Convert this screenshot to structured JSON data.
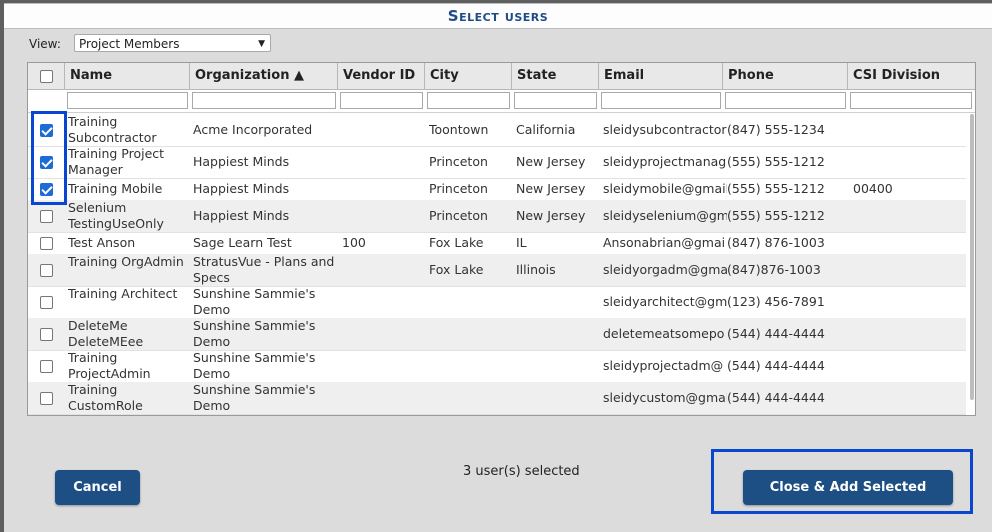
{
  "dialog": {
    "title": "Select users"
  },
  "view": {
    "label": "View:",
    "selected": "Project Members"
  },
  "columns": [
    {
      "label": ""
    },
    {
      "label": "Name"
    },
    {
      "label": "Organization ▲"
    },
    {
      "label": "Vendor ID"
    },
    {
      "label": "City"
    },
    {
      "label": "State"
    },
    {
      "label": "Email"
    },
    {
      "label": "Phone"
    },
    {
      "label": "CSI Division"
    }
  ],
  "rows": [
    {
      "checked": true,
      "name": "Training Subcontractor",
      "org": "Acme Incorporated",
      "vendor": "",
      "city": "Toontown",
      "state": "California",
      "email": "sleidysubcontractor",
      "phone": "(847) 555-1234",
      "csi": ""
    },
    {
      "checked": true,
      "name": "Training Project Manager",
      "org": "Happiest Minds",
      "vendor": "",
      "city": "Princeton",
      "state": "New Jersey",
      "email": "sleidyprojectmanag",
      "phone": "(555) 555-1212",
      "csi": ""
    },
    {
      "checked": true,
      "name": "Training Mobile",
      "org": "Happiest Minds",
      "vendor": "",
      "city": "Princeton",
      "state": "New Jersey",
      "email": "sleidymobile@gmail",
      "phone": "(555) 555-1212",
      "csi": "00400"
    },
    {
      "checked": false,
      "name": "Selenium TestingUseOnly",
      "org": "Happiest Minds",
      "vendor": "",
      "city": "Princeton",
      "state": "New Jersey",
      "email": "sleidyselenium@gm",
      "phone": "(555) 555-1212",
      "csi": ""
    },
    {
      "checked": false,
      "name": "Test Anson",
      "org": "Sage Learn Test",
      "vendor": "100",
      "city": "Fox Lake",
      "state": "IL",
      "email": "Ansonabrian@gmai",
      "phone": "(847) 876-1003",
      "csi": ""
    },
    {
      "checked": false,
      "name": "Training OrgAdmin",
      "org": "StratusVue - Plans and Specs",
      "vendor": "",
      "city": "Fox Lake",
      "state": "Illinois",
      "email": "sleidyorgadm@gma",
      "phone": "(847)876-1003",
      "csi": ""
    },
    {
      "checked": false,
      "name": "Training Architect",
      "org": "Sunshine Sammie's Demo",
      "vendor": "",
      "city": "",
      "state": "",
      "email": "sleidyarchitect@gm",
      "phone": "(123) 456-7891",
      "csi": ""
    },
    {
      "checked": false,
      "name": "DeleteMe DeleteMEee",
      "org": "Sunshine Sammie's Demo",
      "vendor": "",
      "city": "",
      "state": "",
      "email": "deletemeatsomepo",
      "phone": "(544) 444-4444",
      "csi": ""
    },
    {
      "checked": false,
      "name": "Training ProjectAdmin",
      "org": "Sunshine Sammie's Demo",
      "vendor": "",
      "city": "",
      "state": "",
      "email": "sleidyprojectadm@",
      "phone": "(544) 444-4444",
      "csi": ""
    },
    {
      "checked": false,
      "name": "Training CustomRole",
      "org": "Sunshine Sammie's Demo",
      "vendor": "",
      "city": "",
      "state": "",
      "email": "sleidycustom@gmai",
      "phone": "(544) 444-4444",
      "csi": ""
    }
  ],
  "footer": {
    "cancel_label": "Cancel",
    "status": "3 user(s) selected",
    "add_label": "Close & Add Selected"
  }
}
